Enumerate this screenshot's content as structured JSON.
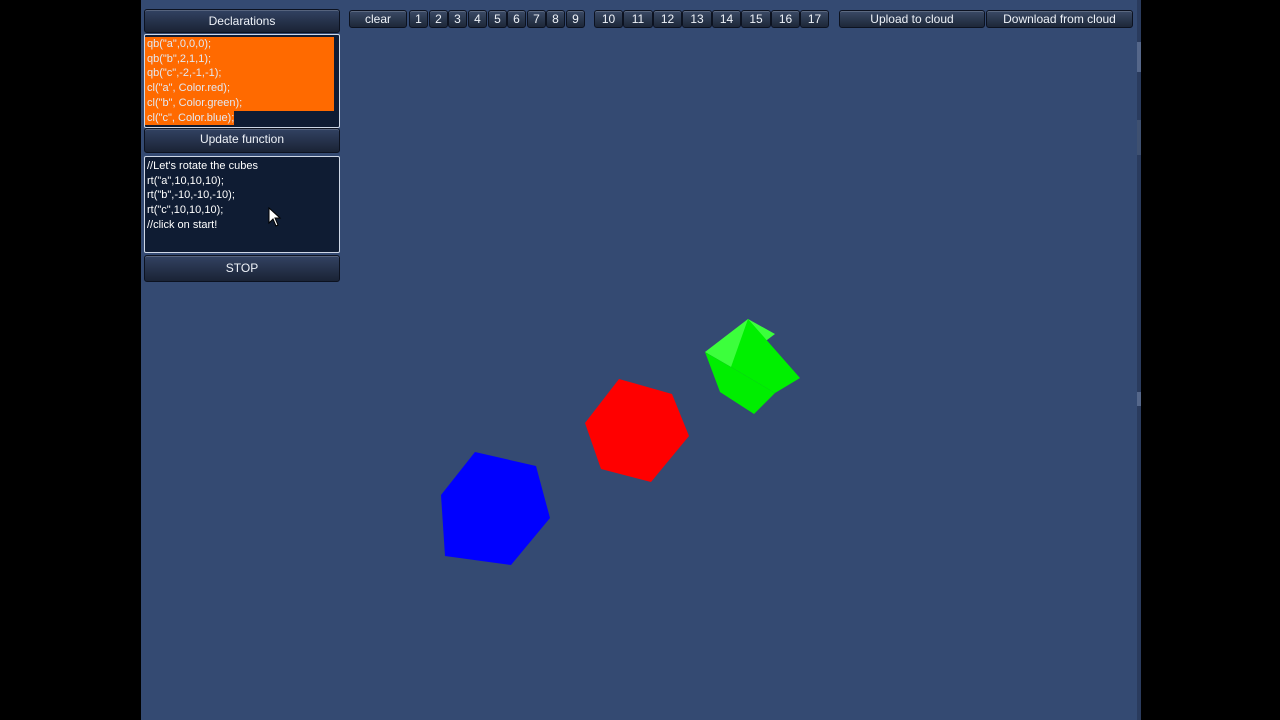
{
  "panel": {
    "declarations_label": "Declarations",
    "declarations_code": [
      "qb(\"a\",0,0,0);",
      "qb(\"b\",2,1,1);",
      "qb(\"c\",-2,-1,-1);",
      "cl(\"a\", Color.red);",
      "cl(\"b\", Color.green);",
      "cl(\"c\", Color.blue);"
    ],
    "update_label": "Update function",
    "update_code": [
      "//Let's rotate the cubes",
      "rt(\"a\",10,10,10);",
      "rt(\"b\",-10,-10,-10);",
      "rt(\"c\",10,10,10);",
      "//click on start!"
    ],
    "stop_label": "STOP"
  },
  "toolbar": {
    "clear_label": "clear",
    "slots": [
      "1",
      "2",
      "3",
      "4",
      "5",
      "6",
      "7",
      "8",
      "9",
      "10",
      "11",
      "12",
      "13",
      "14",
      "15",
      "16",
      "17"
    ],
    "upload_label": "Upload to cloud",
    "download_label": "Download from cloud"
  },
  "scene": {
    "background_color": "#344a72",
    "selection_color": "#ff6a00",
    "cubes": [
      {
        "name": "a",
        "color": "#ff0000"
      },
      {
        "name": "b",
        "color": "#00ff00"
      },
      {
        "name": "c",
        "color": "#0000ff"
      }
    ]
  }
}
